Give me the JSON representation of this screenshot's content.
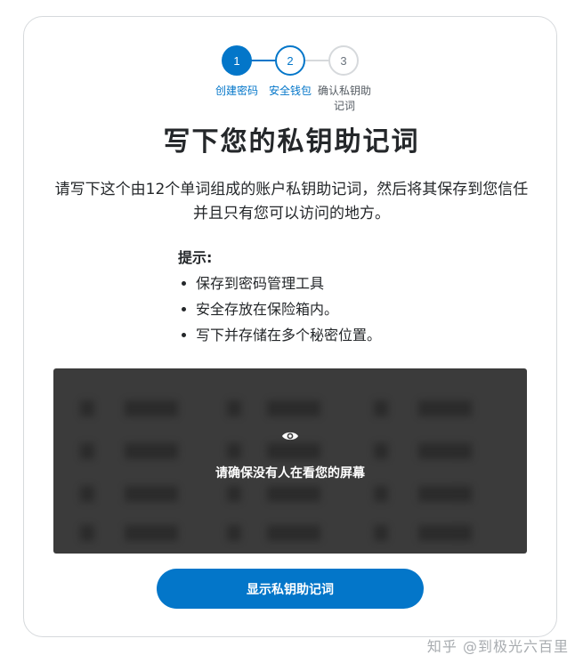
{
  "stepper": {
    "steps": [
      {
        "number": "1",
        "label": "创建密码",
        "state": "completed"
      },
      {
        "number": "2",
        "label": "安全钱包",
        "state": "current"
      },
      {
        "number": "3",
        "label_line1": "确认私钥助",
        "label_line2": "记词",
        "state": "pending"
      }
    ]
  },
  "title": "写下您的私钥助记词",
  "description": "请写下这个由12个单词组成的账户私钥助记词，然后将其保存到您信任并且只有您可以访问的地方。",
  "tips": {
    "title": "提示:",
    "items": [
      "保存到密码管理工具",
      "安全存放在保险箱内。",
      "写下并存储在多个秘密位置。"
    ]
  },
  "reveal_panel": {
    "icon": "eye-icon",
    "warning": "请确保没有人在看您的屏幕"
  },
  "reveal_button": "显示私钥助记词",
  "watermark": "知乎 @到极光六百里",
  "colors": {
    "accent": "#0376c9",
    "panel_bg": "#3b3b3b",
    "border": "#d6d9dc"
  }
}
